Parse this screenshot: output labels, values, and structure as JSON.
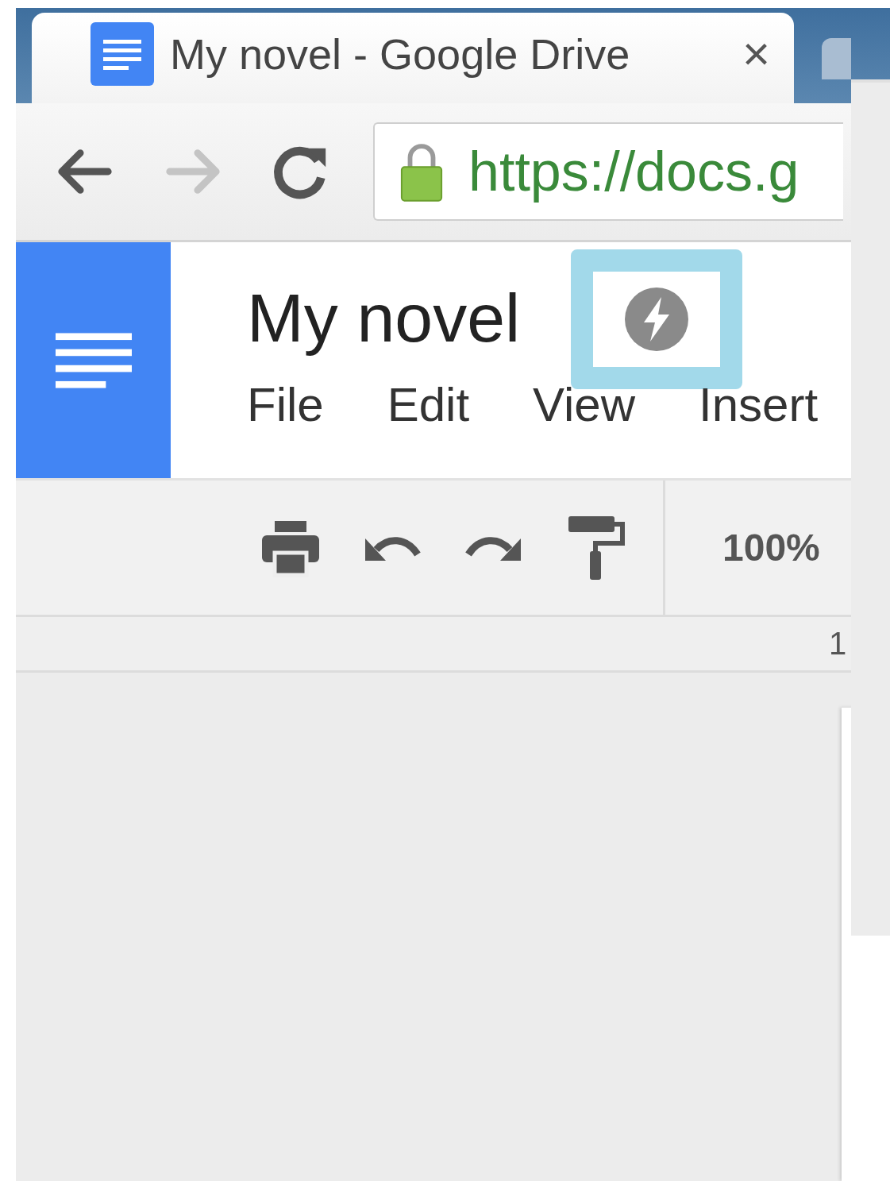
{
  "browser": {
    "tab": {
      "title": "My novel - Google Drive",
      "close": "×"
    },
    "nav": [
      {
        "kind": "back",
        "disabled": false
      },
      {
        "kind": "forward",
        "disabled": true
      },
      {
        "kind": "reload",
        "disabled": false
      }
    ],
    "address": {
      "secure": true,
      "url": "https://docs.g"
    }
  },
  "doc": {
    "title": "My novel",
    "status_icon": {
      "highlighted": true
    },
    "menu": [
      "File",
      "Edit",
      "View",
      "Insert"
    ],
    "toolbar": [
      {
        "kind": "print"
      },
      {
        "kind": "undo"
      },
      {
        "kind": "redo"
      },
      {
        "kind": "paint"
      }
    ],
    "zoom": "100%",
    "ruler": "1"
  }
}
